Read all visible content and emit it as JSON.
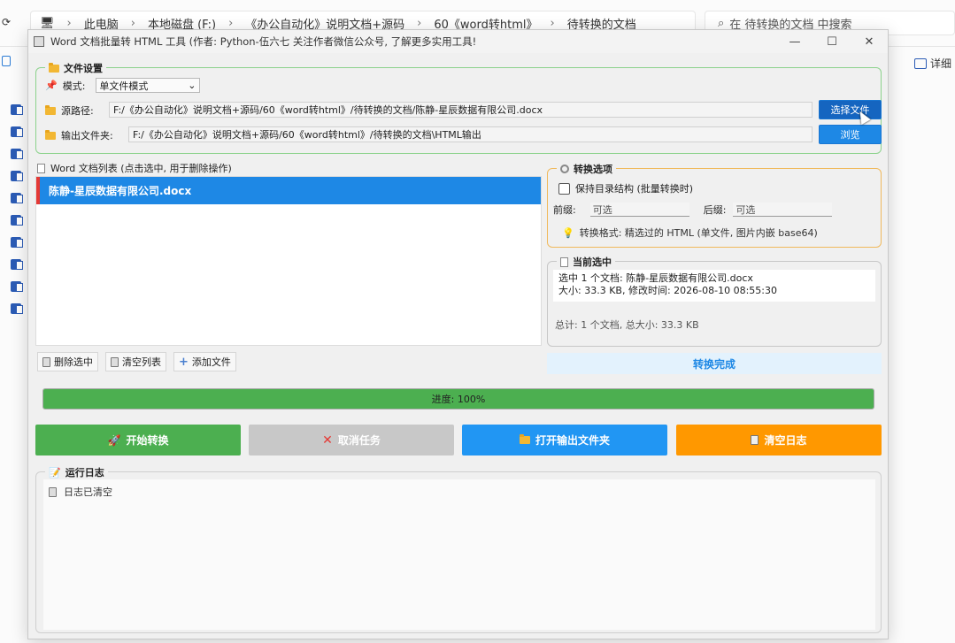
{
  "explorer": {
    "breadcrumb": [
      "此电脑",
      "本地磁盘 (F:)",
      "《办公自动化》说明文档+源码",
      "60《word转html》",
      "待转换的文档"
    ],
    "search_placeholder": "在 待转换的文档 中搜索",
    "view_label": "详细"
  },
  "window": {
    "title": "Word 文档批量转 HTML 工具 (作者: Python-伍六七 关注作者微信公众号, 了解更多实用工具!",
    "controls": [
      "—",
      "☐",
      "✕"
    ]
  },
  "file_settings": {
    "title": "文件设置",
    "mode_label": "模式:",
    "mode_value": "单文件模式",
    "source_label": "源路径:",
    "source_path": "F:/《办公自动化》说明文档+源码/60《word转html》/待转换的文档/陈静-星辰数据有限公司.docx",
    "output_label": "输出文件夹:",
    "output_path": "F:/《办公自动化》说明文档+源码/60《word转html》/待转换的文档\\HTML输出",
    "select_button": "选择文件",
    "browse_button": "浏览"
  },
  "doc_list": {
    "label": "Word 文档列表 (点击选中, 用于删除操作)",
    "items": [
      "陈静-星辰数据有限公司.docx"
    ]
  },
  "list_buttons": {
    "delete": "删除选中",
    "clear": "清空列表",
    "add": "添加文件"
  },
  "convert_options": {
    "title": "转换选项",
    "keep_structure": "保持目录结构 (批量转换时)",
    "prefix_label": "前缀:",
    "prefix_placeholder": "可选",
    "suffix_label": "后缀:",
    "suffix_placeholder": "可选",
    "tip": "转换格式: 精选过的 HTML (单文件, 图片内嵌 base64)"
  },
  "current_selection": {
    "title": "当前选中",
    "line1": "选中 1 个文档: 陈静-星辰数据有限公司.docx",
    "line2": "大小: 33.3 KB, 修改时间: 2026-08-10 08:55:30",
    "total": "总计: 1 个文档, 总大小: 33.3 KB"
  },
  "status_banner": "转换完成",
  "progress": {
    "text": "进度: 100%",
    "value": 1.0,
    "color": "#4caf50"
  },
  "actions": {
    "start": "开始转换",
    "cancel": "取消任务",
    "open_output": "打开输出文件夹",
    "clear_log": "清空日志"
  },
  "log": {
    "title": "运行日志",
    "lines": [
      "日志已清空"
    ]
  },
  "colors": {
    "accent_blue": "#1e88e5",
    "green": "#4caf50",
    "orange": "#ff9800",
    "gray": "#c8c8c8"
  }
}
